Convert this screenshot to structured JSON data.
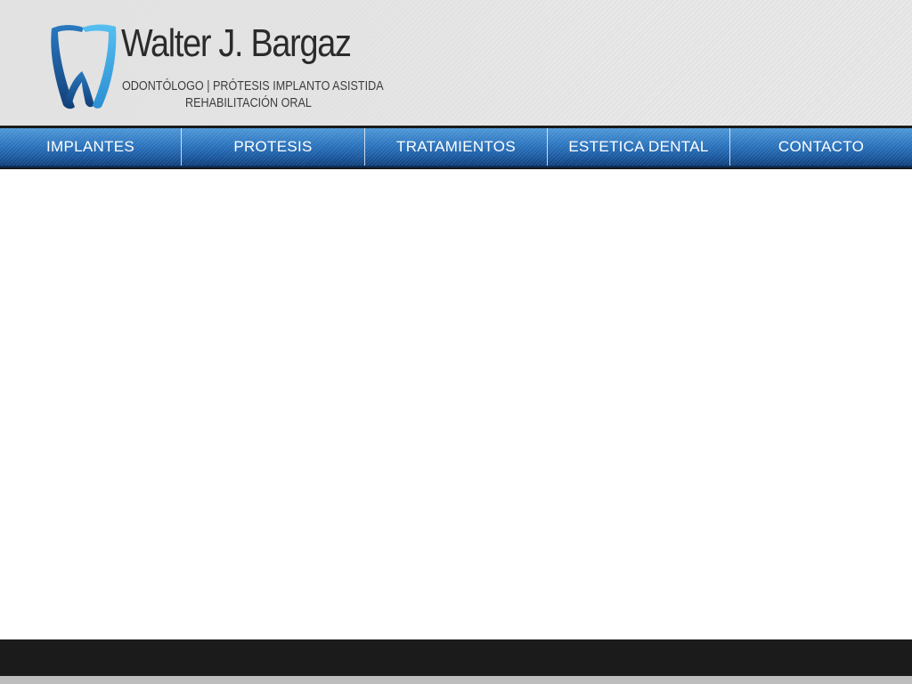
{
  "brand": {
    "name": "Walter J. Bargaz",
    "subtitle_line1": "ODONTÓLOGO | PRÓTESIS IMPLANTO ASISTIDA",
    "subtitle_line2": "REHABILITACIÓN ORAL",
    "logo_icon": "tooth-icon",
    "colors": {
      "logo_dark": "#1a4f8f",
      "logo_light": "#3fa9e0",
      "text": "#2b2b2b"
    }
  },
  "nav": {
    "items": [
      {
        "label": "IMPLANTES"
      },
      {
        "label": "PROTESIS"
      },
      {
        "label": "TRATAMIENTOS"
      },
      {
        "label": "ESTETICA DENTAL"
      },
      {
        "label": "CONTACTO"
      }
    ],
    "colors": {
      "bar_top": "#4d97d8",
      "bar_bottom": "#0f3f79",
      "text": "#ffffff"
    }
  },
  "footer": {
    "colors": {
      "bar": "#1b1b1b",
      "strip": "#bdbdbd"
    }
  }
}
